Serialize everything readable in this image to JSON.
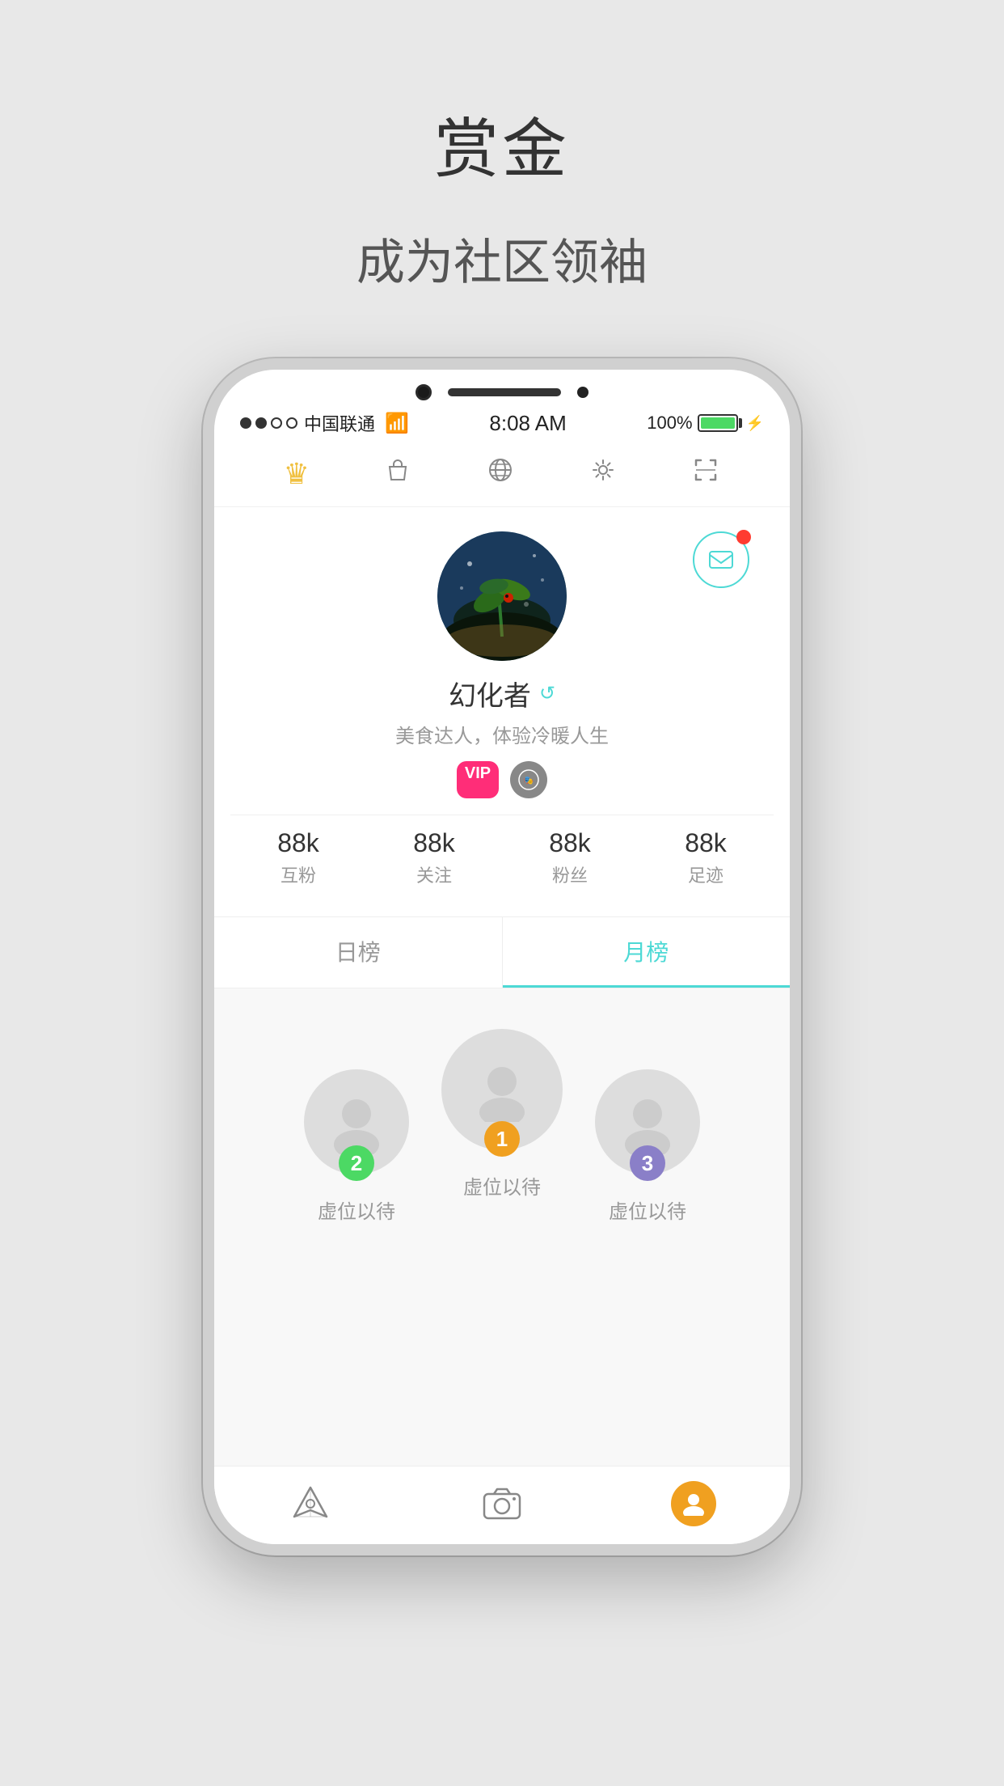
{
  "background": {
    "title": "赏金",
    "subtitle": "成为社区领袖"
  },
  "phone": {
    "status_bar": {
      "carrier": "中国联通",
      "time": "8:08 AM",
      "battery": "100%",
      "signal_dots": [
        "full",
        "full",
        "empty",
        "empty"
      ]
    },
    "nav": {
      "icons": [
        {
          "name": "crown",
          "symbol": "♛",
          "active": true
        },
        {
          "name": "bag",
          "symbol": "👜",
          "active": false
        },
        {
          "name": "globe",
          "symbol": "🌐",
          "active": false
        },
        {
          "name": "gear",
          "symbol": "⚙️",
          "active": false
        },
        {
          "name": "scan",
          "symbol": "▣",
          "active": false
        }
      ]
    },
    "profile": {
      "username": "幻化者",
      "bio": "美食达人，体验冷暖人生",
      "edit_icon": "↺",
      "stats": [
        {
          "label": "互粉",
          "value": "88k"
        },
        {
          "label": "关注",
          "value": "88k"
        },
        {
          "label": "粉丝",
          "value": "88k"
        },
        {
          "label": "足迹",
          "value": "88k"
        }
      ]
    },
    "tabs": [
      {
        "label": "日榜",
        "active": false
      },
      {
        "label": "月榜",
        "active": true
      }
    ],
    "leaderboard": {
      "items": [
        {
          "rank": 2,
          "name": "虚位以待",
          "rank_color": "#4cd964"
        },
        {
          "rank": 1,
          "name": "虚位以待",
          "rank_color": "#f0a020"
        },
        {
          "rank": 3,
          "name": "虚位以待",
          "rank_color": "#8a7fc8"
        }
      ]
    },
    "bottom_bar": {
      "tabs": [
        {
          "name": "explore",
          "label": ""
        },
        {
          "name": "camera",
          "label": ""
        },
        {
          "name": "profile",
          "label": ""
        }
      ]
    }
  }
}
